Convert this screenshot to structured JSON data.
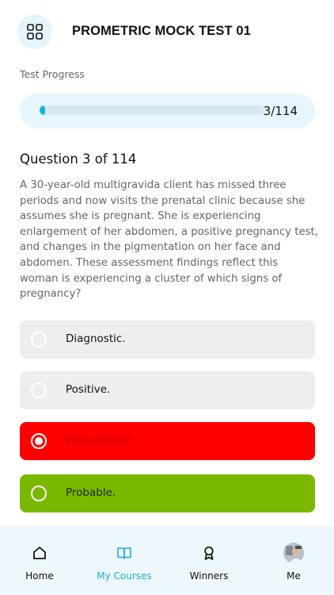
{
  "header": {
    "title": "PROMETRIC MOCK TEST 01",
    "menu_icon": "grid-icon"
  },
  "progress": {
    "label": "Test Progress",
    "current": 3,
    "total": 114,
    "count_text": "3/114",
    "fill_fraction": 0.026
  },
  "question": {
    "heading": "Question 3 of 114",
    "text": "A 30-year-old multigravida client has missed three periods and now visits the prenatal clinic because she assumes she is pregnant. She is experiencing enlargement of her abdomen, a positive pregnancy test, and changes in the pigmentation on her face and abdomen. These assessment findings reflect  this woman is experiencing a cluster of which signs of pregnancy?"
  },
  "options": [
    {
      "label": "Diagnostic.",
      "state": "neutral"
    },
    {
      "label": "Positive.",
      "state": "neutral"
    },
    {
      "label": "Presumptive",
      "state": "wrong-selected"
    },
    {
      "label": "Probable.",
      "state": "correct"
    }
  ],
  "colors": {
    "accent": "#1ab0dc",
    "neutral_option": "#eeeeee",
    "wrong": "#ff0000",
    "correct": "#7ab800"
  },
  "bottom_nav": [
    {
      "label": "Home",
      "icon": "home-icon"
    },
    {
      "label": "My Courses",
      "icon": "book-icon",
      "active": true
    },
    {
      "label": "Winners",
      "icon": "award-icon"
    },
    {
      "label": "Me",
      "icon": "avatar"
    }
  ]
}
